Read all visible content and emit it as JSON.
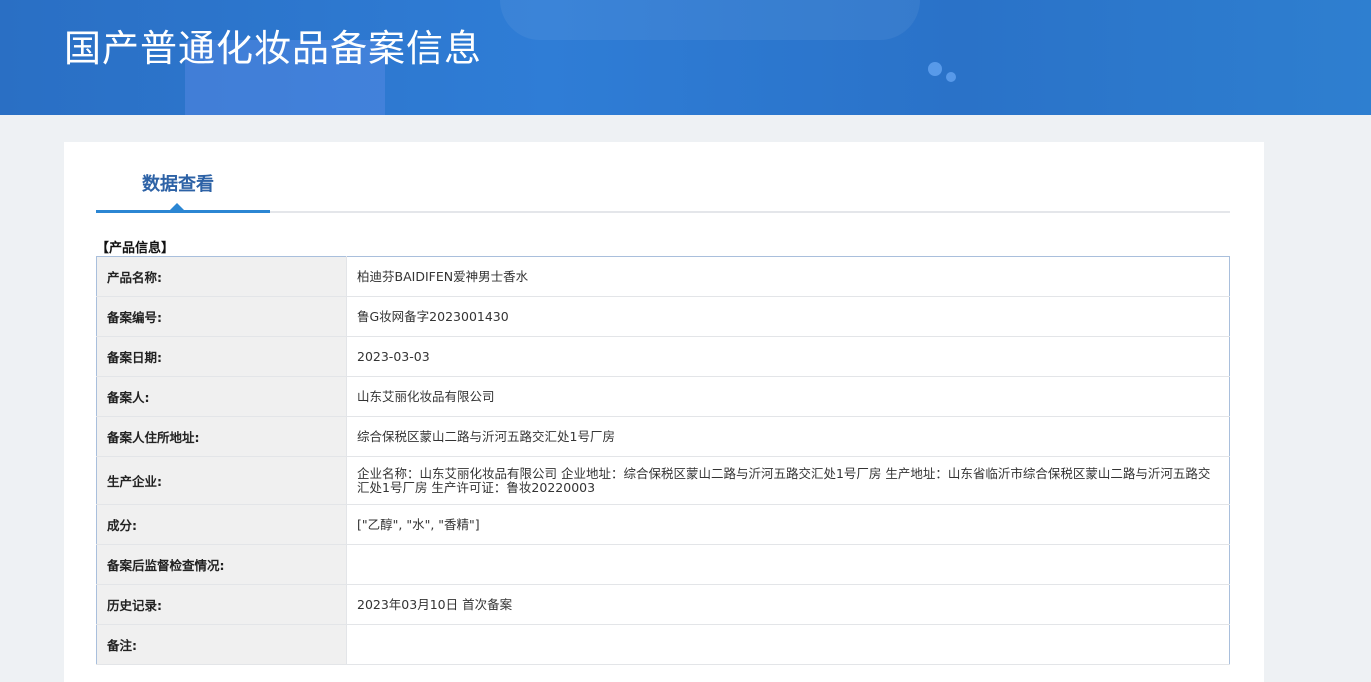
{
  "header": {
    "title": "国产普通化妆品备案信息"
  },
  "tab": {
    "label": "数据查看"
  },
  "section": {
    "title": "【产品信息】"
  },
  "rows": [
    {
      "label": "产品名称:",
      "value": "柏迪芬BAIDIFEN爱神男士香水"
    },
    {
      "label": "备案编号:",
      "value": "鲁G妆网备字2023001430"
    },
    {
      "label": "备案日期:",
      "value": "2023-03-03"
    },
    {
      "label": "备案人:",
      "value": "山东艾丽化妆品有限公司"
    },
    {
      "label": "备案人住所地址:",
      "value": "综合保税区蒙山二路与沂河五路交汇处1号厂房"
    },
    {
      "label": "生产企业:",
      "value": "企业名称：山东艾丽化妆品有限公司 企业地址：综合保税区蒙山二路与沂河五路交汇处1号厂房 生产地址：山东省临沂市综合保税区蒙山二路与沂河五路交汇处1号厂房 生产许可证：鲁妆20220003"
    },
    {
      "label": "成分:",
      "value": "[\"乙醇\", \"水\", \"香精\"]"
    },
    {
      "label": "备案后监督检查情况:",
      "value": ""
    },
    {
      "label": "历史记录:",
      "value": "2023年03月10日 首次备案"
    },
    {
      "label": "备注:",
      "value": ""
    }
  ]
}
